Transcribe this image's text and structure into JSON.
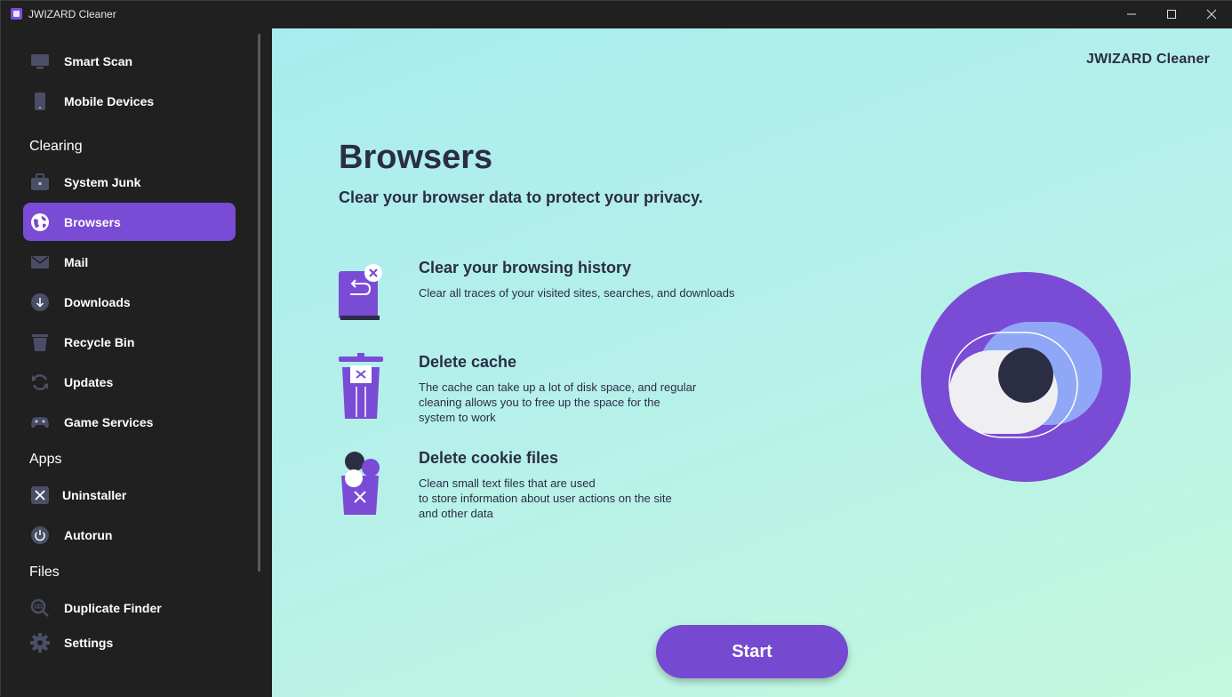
{
  "window": {
    "title": "JWIZARD Cleaner"
  },
  "sidebar": {
    "items": [
      {
        "label": "Smart Scan",
        "icon": "monitor-icon"
      },
      {
        "label": "Mobile Devices",
        "icon": "phone-icon"
      },
      {
        "label": "System Junk",
        "icon": "briefcase-icon"
      },
      {
        "label": "Browsers",
        "icon": "globe-icon",
        "active": true
      },
      {
        "label": "Mail",
        "icon": "mail-icon"
      },
      {
        "label": "Downloads",
        "icon": "download-icon"
      },
      {
        "label": "Recycle Bin",
        "icon": "trash-icon"
      },
      {
        "label": "Updates",
        "icon": "refresh-icon"
      },
      {
        "label": "Game Services",
        "icon": "gamepad-icon"
      },
      {
        "label": "Uninstaller",
        "icon": "close-box-icon"
      },
      {
        "label": "Autorun",
        "icon": "power-icon"
      },
      {
        "label": "Duplicate Finder",
        "icon": "magnifier-icon"
      },
      {
        "label": "Settings",
        "icon": "gear-icon"
      }
    ],
    "sections": {
      "clearing": "Clearing",
      "apps": "Apps",
      "files": "Files"
    }
  },
  "main": {
    "brand": "JWIZARD Cleaner",
    "title": "Browsers",
    "subtitle": "Clear your browser data to protect your privacy.",
    "features": [
      {
        "title": "Clear your browsing history",
        "description": "Clear all traces of your visited sites, searches, and downloads"
      },
      {
        "title": "Delete cache",
        "description": "The cache can take up a lot of disk space, and regular\ncleaning allows you to free up the space for the\nsystem to work"
      },
      {
        "title": "Delete cookie files",
        "description": "Clean small text files that are used\nto store information about user actions on the site\nand other data"
      }
    ],
    "start_label": "Start"
  },
  "colors": {
    "accent": "#7a4bd4",
    "sidebar_bg": "#202020",
    "text_dark": "#2b2d45"
  }
}
